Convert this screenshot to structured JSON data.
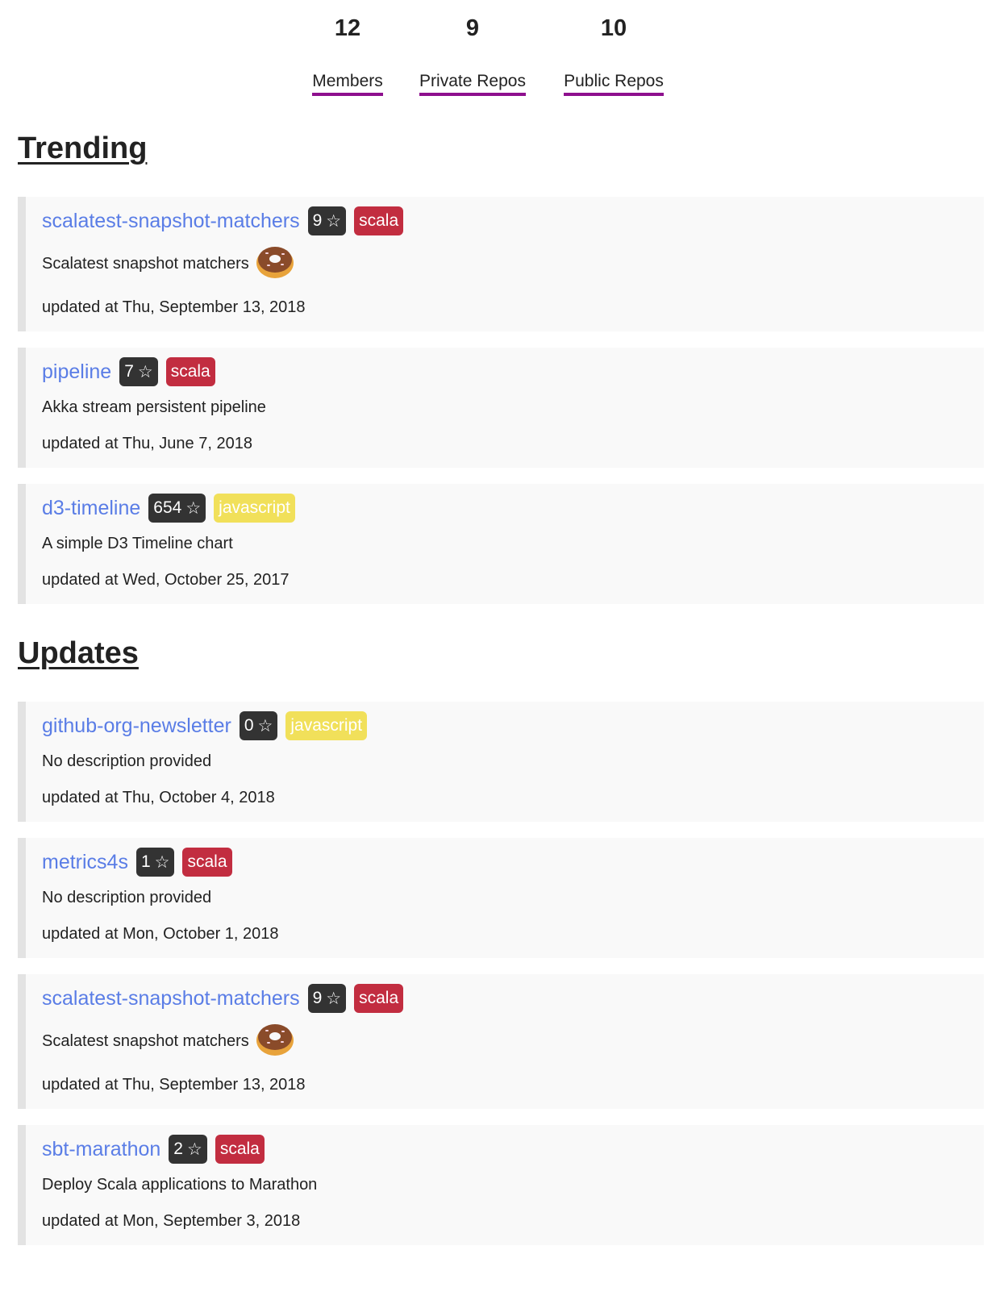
{
  "stats": [
    {
      "value": "12",
      "label": "Members"
    },
    {
      "value": "9",
      "label": "Private Repos"
    },
    {
      "value": "10",
      "label": "Public Repos"
    }
  ],
  "trending": {
    "title": "Trending",
    "repos": [
      {
        "name": "scalatest-snapshot-matchers",
        "stars": "9",
        "language": "scala",
        "description": "Scalatest snapshot matchers",
        "emoji": "donut-icon",
        "updated": "updated at Thu, September 13, 2018"
      },
      {
        "name": "pipeline",
        "stars": "7",
        "language": "scala",
        "description": "Akka stream persistent pipeline",
        "emoji": "",
        "updated": "updated at Thu, June 7, 2018"
      },
      {
        "name": "d3-timeline",
        "stars": "654",
        "language": "javascript",
        "description": "A simple D3 Timeline chart",
        "emoji": "",
        "updated": "updated at Wed, October 25, 2017"
      }
    ]
  },
  "updates": {
    "title": "Updates",
    "repos": [
      {
        "name": "github-org-newsletter",
        "stars": "0",
        "language": "javascript",
        "description": "No description provided",
        "emoji": "",
        "updated": "updated at Thu, October 4, 2018"
      },
      {
        "name": "metrics4s",
        "stars": "1",
        "language": "scala",
        "description": "No description provided",
        "emoji": "",
        "updated": "updated at Mon, October 1, 2018"
      },
      {
        "name": "scalatest-snapshot-matchers",
        "stars": "9",
        "language": "scala",
        "description": "Scalatest snapshot matchers",
        "emoji": "donut-icon",
        "updated": "updated at Thu, September 13, 2018"
      },
      {
        "name": "sbt-marathon",
        "stars": "2",
        "language": "scala",
        "description": "Deploy Scala applications to Marathon",
        "emoji": "",
        "updated": "updated at Mon, September 3, 2018"
      }
    ]
  },
  "star_glyph": "☆",
  "colors": {
    "link": "#5a7de6",
    "stat_underline": "#8e0f8e",
    "scala": "#c22d40",
    "javascript": "#f1e05a",
    "stars_badge": "#333333",
    "card_border": "#e3e3e3",
    "card_bg": "#f9f9f9"
  }
}
